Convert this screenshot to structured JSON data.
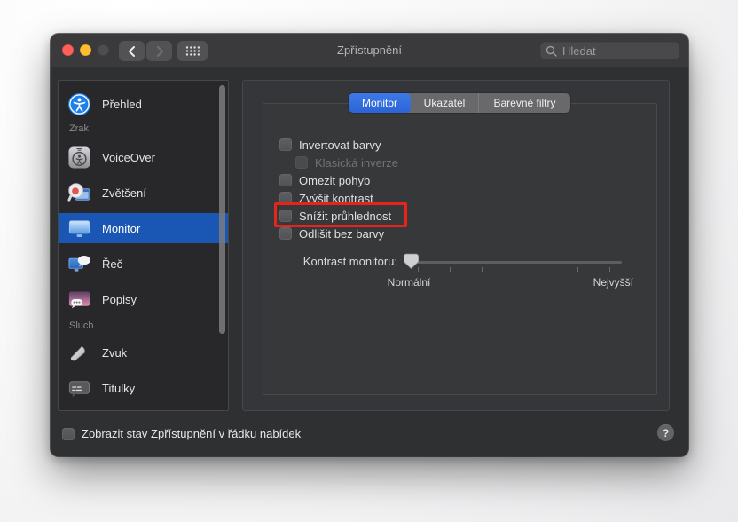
{
  "window": {
    "title": "Zpřístupnění",
    "traffic_lights": {
      "close_color": "#ff5f57",
      "minimize_color": "#febc2e",
      "zoom_disabled_color": "#4d4d50"
    },
    "search": {
      "placeholder": "Hledat",
      "icon": "magnifier-icon"
    },
    "nav": {
      "back_icon": "chevron-left-icon",
      "forward_icon": "chevron-right-icon",
      "show_all_icon": "grid-icon"
    },
    "help_label": "?"
  },
  "sidebar": {
    "items": [
      {
        "label": "Přehled",
        "type": "item",
        "icon": "accessibility-overview-icon",
        "selected": false
      },
      {
        "label": "Zrak",
        "type": "section"
      },
      {
        "label": "VoiceOver",
        "type": "item",
        "icon": "voiceover-icon",
        "selected": false
      },
      {
        "label": "Zvětšení",
        "type": "item",
        "icon": "zoom-magnifier-icon",
        "selected": false
      },
      {
        "label": "Monitor",
        "type": "item",
        "icon": "display-icon",
        "selected": true
      },
      {
        "label": "Řeč",
        "type": "item",
        "icon": "speech-icon",
        "selected": false
      },
      {
        "label": "Popisy",
        "type": "item",
        "icon": "descriptions-icon",
        "selected": false
      },
      {
        "label": "Sluch",
        "type": "section"
      },
      {
        "label": "Zvuk",
        "type": "item",
        "icon": "audio-icon",
        "selected": false
      },
      {
        "label": "Titulky",
        "type": "item",
        "icon": "captions-icon",
        "selected": false
      }
    ]
  },
  "main": {
    "tabs": [
      {
        "label": "Monitor",
        "selected": true
      },
      {
        "label": "Ukazatel",
        "selected": false
      },
      {
        "label": "Barevné filtry",
        "selected": false
      }
    ],
    "checkboxes": [
      {
        "label": "Invertovat barvy",
        "checked": false,
        "disabled": false
      },
      {
        "label": "Klasická inverze",
        "checked": false,
        "disabled": true,
        "indented": true
      },
      {
        "label": "Omezit pohyb",
        "checked": false,
        "disabled": false
      },
      {
        "label": "Zvýšit kontrast",
        "checked": false,
        "disabled": false
      },
      {
        "label": "Snížit průhlednost",
        "checked": false,
        "disabled": false,
        "annotated": true
      },
      {
        "label": "Odlišit bez barvy",
        "checked": false,
        "disabled": false
      }
    ],
    "slider": {
      "label": "Kontrast monitoru:",
      "min_label": "Normální",
      "max_label": "Nejvyšší",
      "value_percent": 0,
      "tick_count": 7
    }
  },
  "footer": {
    "checkbox_label": "Zobrazit stav Zpřístupnění v řádku nabídek",
    "checked": false
  },
  "annotation": {
    "shape": "red-rectangle",
    "color": "#e7231c",
    "target": "Snížit průhlednost"
  },
  "colors": {
    "sidebar_selection_blue": "#1a56b4",
    "tab_selected_blue": "#2e6bdf",
    "annotation_red": "#e7231c",
    "window_body": "#2f3032",
    "titlebar": "#3a3a3c"
  }
}
